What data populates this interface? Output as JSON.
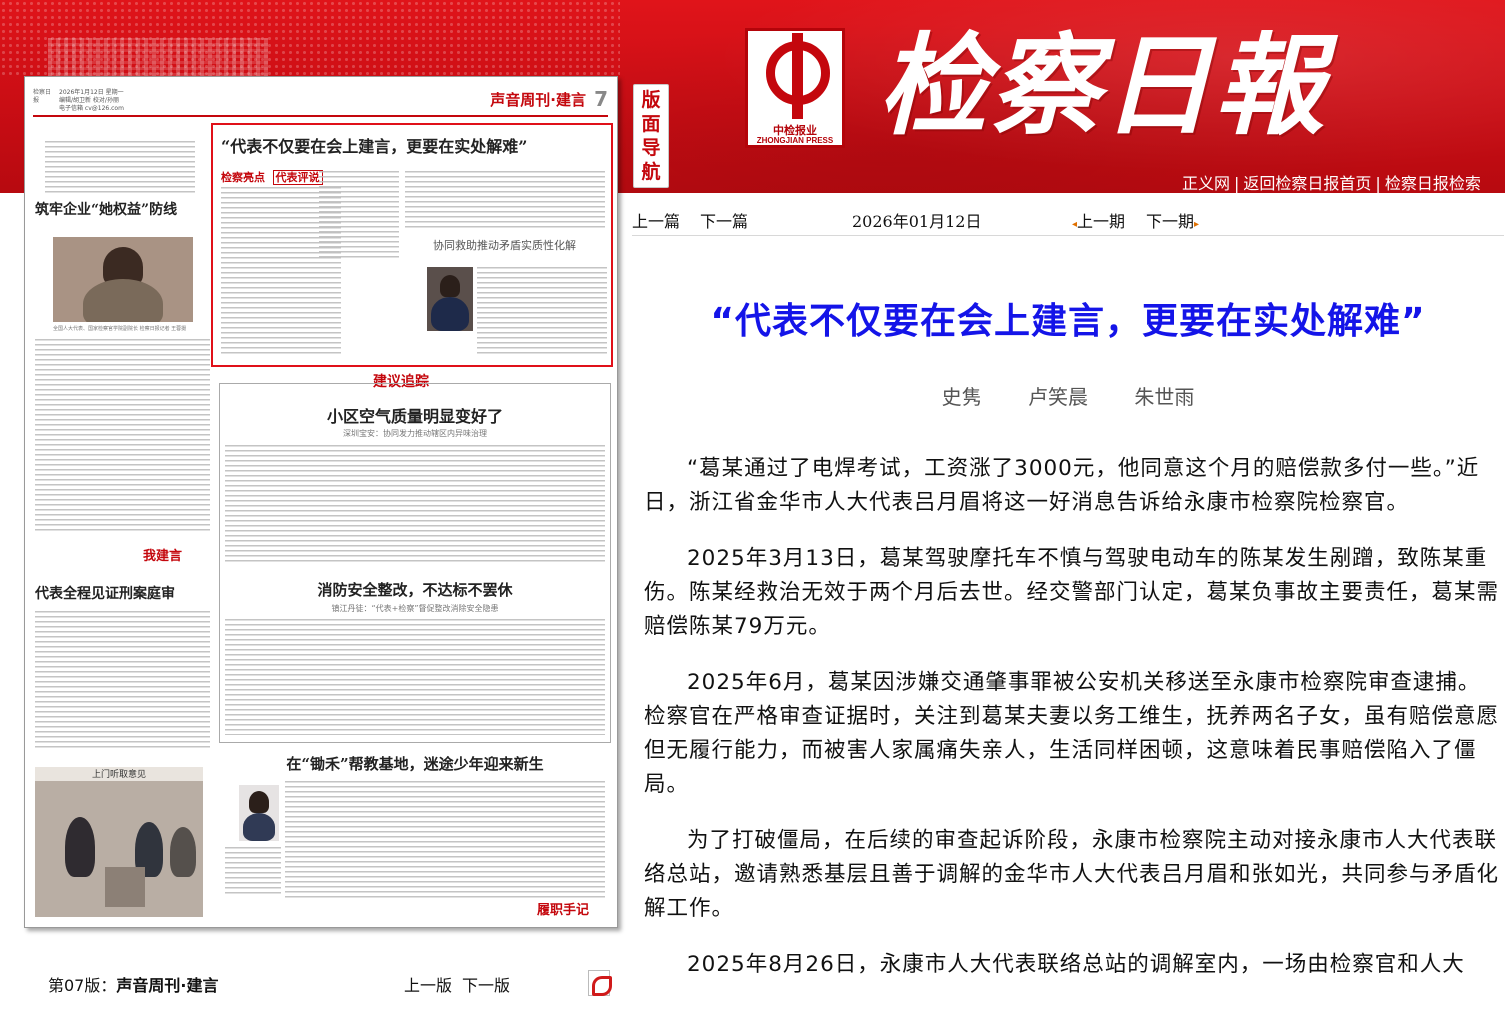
{
  "brand": {
    "masthead": "检察日報",
    "logo_cn": "中检报业",
    "logo_en": "ZHONGJIAN PRESS"
  },
  "top_links": [
    "正义网",
    "返回检察日报首页",
    "检察日报检索"
  ],
  "layout_nav_tag": [
    "版",
    "面",
    "导",
    "航"
  ],
  "page_thumbnail": {
    "masthead": "检察日报",
    "date_lines": [
      "2026年1月12日 星期一",
      "编辑/胡卫新 校对/孙丽",
      "电子信箱 cv@126.com"
    ],
    "section_title": "声音周刊·建言",
    "page_no": "7",
    "left_col_headline": "筑牢企业“她权益”防线",
    "left_col_caption": "全国人大代表、国家检察官学院副院长 检察日报记者 王蓉摄",
    "left_col_lower_headline": "代表全程见证刑案庭审",
    "left_col_lower_tag": "我建言",
    "photo_caption": "上门听取意见",
    "main_headline": "“代表不仅要在会上建言，更要在实处解难”",
    "main_tag_a": "检察亮点",
    "main_tag_b": "代表评说",
    "side_headline": "协同救助推动矛盾实质性化解",
    "track_tag": "建议追踪",
    "story2_headline": "小区空气质量明显变好了",
    "story2_sub": "深圳宝安：协同发力推动辖区内异味治理",
    "story3_headline": "消防安全整改，不达标不罢休",
    "story3_sub": "镇江丹徒：“代表+检察”督促整改消除安全隐患",
    "story4_headline": "在“锄禾”帮教基地，迷途少年迎来新生",
    "footer_tag": "履职手记"
  },
  "page_controls": {
    "page_label": "第07版：",
    "page_name": "声音周刊·建言",
    "prev_page": "上一版",
    "next_page": "下一版"
  },
  "article_nav": {
    "prev_article": "上一篇",
    "next_article": "下一篇",
    "date": "2026年01月12日",
    "prev_issue": "上一期",
    "next_issue": "下一期"
  },
  "article": {
    "title": "“代表不仅要在会上建言，更要在实处解难”",
    "authors": [
      "史隽",
      "卢笑晨",
      "朱世雨"
    ],
    "paragraphs": [
      "“葛某通过了电焊考试，工资涨了3000元，他同意这个月的赔偿款多付一些。”近日，浙江省金华市人大代表吕月眉将这一好消息告诉给永康市检察院检察官。",
      "2025年3月13日，葛某驾驶摩托车不慎与驾驶电动车的陈某发生剐蹭，致陈某重伤。陈某经救治无效于两个月后去世。经交警部门认定，葛某负事故主要责任，葛某需赔偿陈某79万元。",
      "2025年6月，葛某因涉嫌交通肇事罪被公安机关移送至永康市检察院审查逮捕。检察官在严格审查证据时，关注到葛某夫妻以务工维生，抚养两名子女，虽有赔偿意愿但无履行能力，而被害人家属痛失亲人，生活同样困顿，这意味着民事赔偿陷入了僵局。",
      "为了打破僵局，在后续的审查起诉阶段，永康市检察院主动对接永康市人大代表联络总站，邀请熟悉基层且善于调解的金华市人大代表吕月眉和张如光，共同参与矛盾化解工作。",
      "2025年8月26日，永康市人大代表联络总站的调解室内，一场由检察官和人大"
    ]
  },
  "colors": {
    "header_red": "#c90d14",
    "title_blue": "#1414e8",
    "highlight_red": "#e01019"
  }
}
